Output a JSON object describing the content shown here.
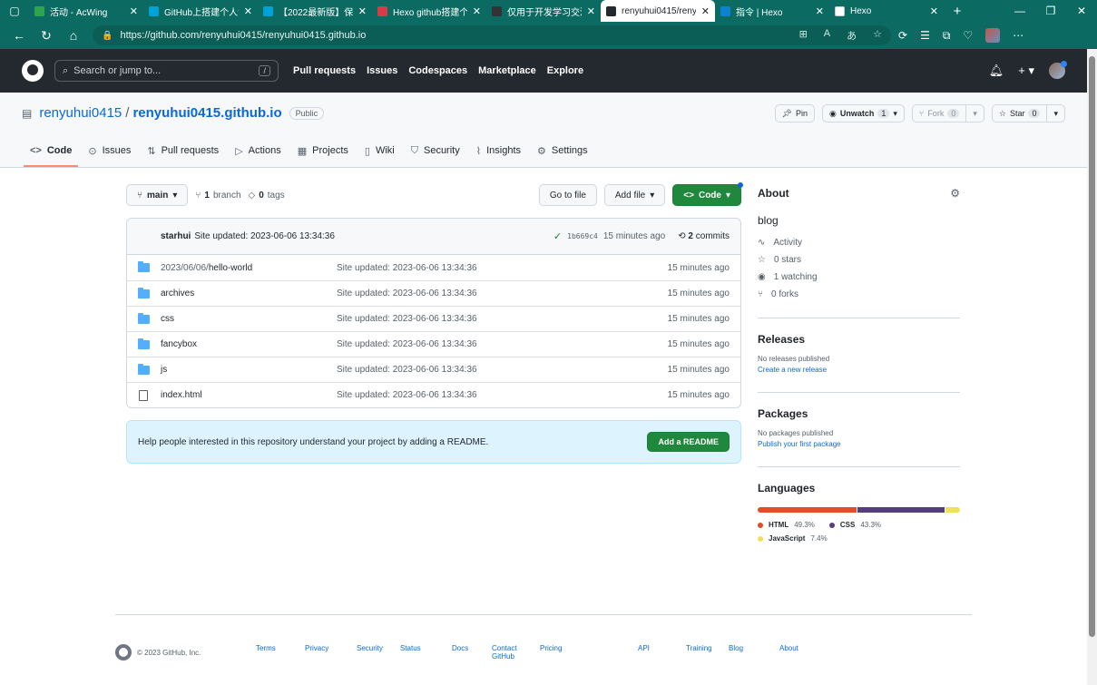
{
  "browser": {
    "tabs": [
      {
        "label": "活动 - AcWing",
        "color": "#2ea44f"
      },
      {
        "label": "GitHub上搭建个人博",
        "color": "#00a1d6"
      },
      {
        "label": "【2022最新版】保",
        "color": "#00a1d6"
      },
      {
        "label": "Hexo github搭建个",
        "color": "#d73a49"
      },
      {
        "label": "仅用于开发学习交流",
        "color": "#333333"
      },
      {
        "label": "renyuhui0415/reny",
        "color": "#24292f",
        "active": true
      },
      {
        "label": "指令 | Hexo",
        "color": "#0e83cd"
      },
      {
        "label": "Hexo",
        "color": "#ffffff"
      }
    ],
    "url": "https://github.com/renyuhui0415/renyuhui0415.github.io"
  },
  "header": {
    "search_placeholder": "Search or jump to...",
    "search_key": "/",
    "nav": [
      "Pull requests",
      "Issues",
      "Codespaces",
      "Marketplace",
      "Explore"
    ]
  },
  "repo": {
    "owner": "renyuhui0415",
    "name": "renyuhui0415.github.io",
    "visibility": "Public",
    "pin_label": "Pin",
    "unwatch_label": "Unwatch",
    "watch_count": "1",
    "fork_label": "Fork",
    "fork_count": "0",
    "star_label": "Star",
    "star_count": "0",
    "tabs": [
      "Code",
      "Issues",
      "Pull requests",
      "Actions",
      "Projects",
      "Wiki",
      "Security",
      "Insights",
      "Settings"
    ]
  },
  "toolbar": {
    "branch": "main",
    "branch_count": "1",
    "branch_label": "branch",
    "tag_count": "0",
    "tag_label": "tags",
    "goto_file": "Go to file",
    "add_file": "Add file",
    "code": "Code"
  },
  "commit": {
    "author": "starhui",
    "message": "Site updated: 2023-06-06 13:34:36",
    "sha": "1b669c4",
    "time": "15 minutes ago",
    "count": "2",
    "count_label": "commits"
  },
  "files": [
    {
      "prefix": "2023/06/06/",
      "name": "hello-world",
      "type": "folder",
      "message": "Site updated: 2023-06-06 13:34:36",
      "time": "15 minutes ago"
    },
    {
      "prefix": "",
      "name": "archives",
      "type": "folder",
      "message": "Site updated: 2023-06-06 13:34:36",
      "time": "15 minutes ago"
    },
    {
      "prefix": "",
      "name": "css",
      "type": "folder",
      "message": "Site updated: 2023-06-06 13:34:36",
      "time": "15 minutes ago"
    },
    {
      "prefix": "",
      "name": "fancybox",
      "type": "folder",
      "message": "Site updated: 2023-06-06 13:34:36",
      "time": "15 minutes ago"
    },
    {
      "prefix": "",
      "name": "js",
      "type": "folder",
      "message": "Site updated: 2023-06-06 13:34:36",
      "time": "15 minutes ago"
    },
    {
      "prefix": "",
      "name": "index.html",
      "type": "file",
      "message": "Site updated: 2023-06-06 13:34:36",
      "time": "15 minutes ago"
    }
  ],
  "readme": {
    "text": "Help people interested in this repository understand your project by adding a README.",
    "button": "Add a README"
  },
  "about": {
    "title": "About",
    "description": "blog",
    "activity": "Activity",
    "stars": "0 stars",
    "watching": "1 watching",
    "forks": "0 forks"
  },
  "releases": {
    "title": "Releases",
    "empty": "No releases published",
    "link": "Create a new release"
  },
  "packages": {
    "title": "Packages",
    "empty": "No packages published",
    "link": "Publish your first package"
  },
  "languages": {
    "title": "Languages",
    "items": [
      {
        "name": "HTML",
        "percent": 49.3,
        "label": "49.3%",
        "color": "#e34c26"
      },
      {
        "name": "CSS",
        "percent": 43.3,
        "label": "43.3%",
        "color": "#563d7c"
      },
      {
        "name": "JavaScript",
        "percent": 7.4,
        "label": "7.4%",
        "color": "#f1e05a"
      }
    ]
  },
  "footer": {
    "copyright": "© 2023 GitHub, Inc.",
    "links": [
      "Terms",
      "Privacy",
      "Security",
      "Status",
      "Docs",
      "Contact GitHub",
      "Pricing",
      "API",
      "Training",
      "Blog",
      "About"
    ]
  }
}
